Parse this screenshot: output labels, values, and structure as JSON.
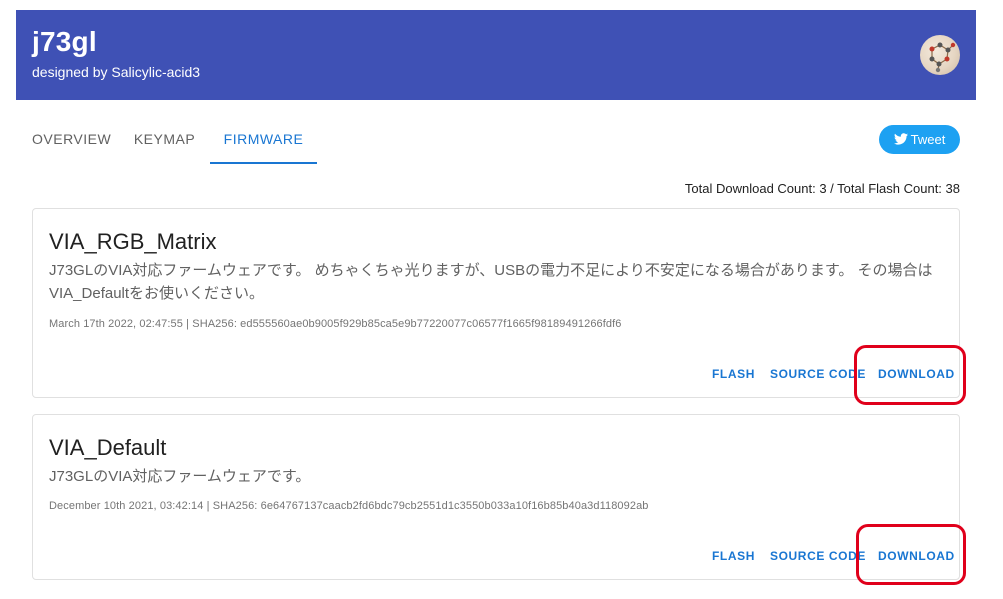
{
  "header": {
    "title": "j73gl",
    "subtitle": "designed by Salicylic-acid3",
    "avatar_icon": "user-avatar"
  },
  "tabs": [
    {
      "label": "OVERVIEW",
      "active": false
    },
    {
      "label": "KEYMAP",
      "active": false
    },
    {
      "label": "FIRMWARE",
      "active": true
    }
  ],
  "tweet": {
    "label": "Tweet",
    "icon": "twitter-bird-icon"
  },
  "counts": "Total Download Count: 3 / Total Flash Count: 38",
  "firmwares": [
    {
      "name": "VIA_RGB_Matrix",
      "description": "J73GLのVIA対応ファームウェアです。 めちゃくちゃ光りますが、USBの電力不足により不安定になる場合があります。 その場合はVIA_Defaultをお使いください。",
      "meta": "March 17th 2022, 02:47:55 | SHA256: ed555560ae0b9005f929b85ca5e9b77220077c06577f1665f98189491266fdf6",
      "flash_label": "FLASH",
      "source_label": "SOURCE CODE",
      "download_label": "DOWNLOAD"
    },
    {
      "name": "VIA_Default",
      "description": "J73GLのVIA対応ファームウェアです。",
      "meta": "December 10th 2021, 03:42:14 | SHA256: 6e64767137caacb2fd6bdc79cb2551d1c3550b033a10f16b85b40a3d118092ab",
      "flash_label": "FLASH",
      "source_label": "SOURCE CODE",
      "download_label": "DOWNLOAD"
    }
  ],
  "highlight_color": "#e0001b",
  "accent_color": "#1976d2",
  "header_color": "#3f51b5"
}
